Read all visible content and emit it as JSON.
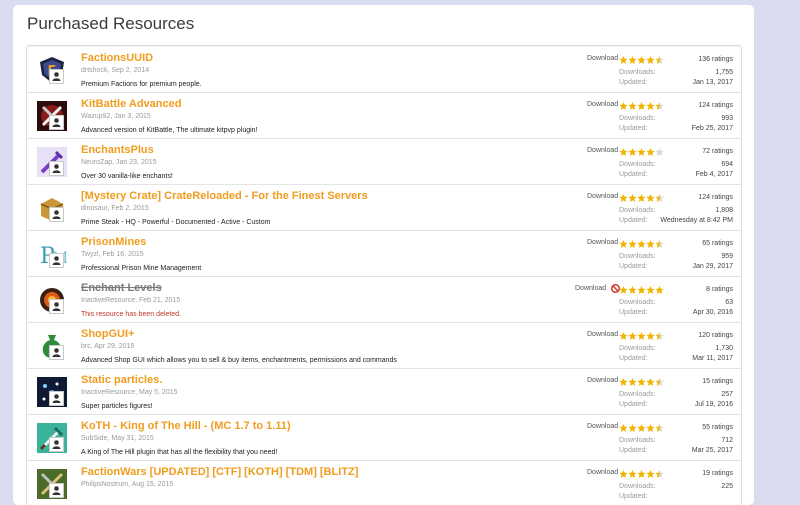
{
  "page": {
    "title": "Purchased Resources"
  },
  "labels": {
    "downloads": "Downloads:",
    "updated": "Updated:"
  },
  "colors": {
    "title": "#f09c1e",
    "star": "#f0b400",
    "deleted": "#c0392b"
  },
  "resources": [
    {
      "icon": "factions-shield-icon",
      "title": "FactionsUUID",
      "author": "drtshock",
      "date": "Sep 2, 2014",
      "description": "Premium Factions for premium people.",
      "download": "Download",
      "stars": 4.5,
      "ratings": "136 ratings",
      "downloads": "1,755",
      "updated": "Jan 13, 2017",
      "deleted": false
    },
    {
      "icon": "kitbattle-icon",
      "title": "KitBattle Advanced",
      "author": "Wazup92",
      "date": "Jan 3, 2015",
      "description": "Advanced version of KitBattle, The ultimate kitpvp plugin!",
      "download": "Download",
      "stars": 4.5,
      "ratings": "124 ratings",
      "downloads": "993",
      "updated": "Feb 25, 2017",
      "deleted": false
    },
    {
      "icon": "enchants-plus-icon",
      "title": "EnchantsPlus",
      "author": "NeuroZap",
      "date": "Jan 23, 2015",
      "description": "Over 30 vanilla-like enchants!",
      "download": "Download",
      "stars": 4,
      "ratings": "72 ratings",
      "downloads": "694",
      "updated": "Feb 4, 2017",
      "deleted": false
    },
    {
      "icon": "crate-icon",
      "title": "[Mystery Crate] CrateReloaded - For the Finest Servers",
      "author": "dinosaur",
      "date": "Feb 2, 2015",
      "description": "Prime Steak - HQ - Powerful - Documented - Active - Custom",
      "download": "Download",
      "stars": 4.5,
      "ratings": "124 ratings",
      "downloads": "1,808",
      "updated": "Wednesday at 8:42 PM",
      "deleted": false
    },
    {
      "icon": "prison-mines-icon",
      "title": "PrisonMines",
      "author": "Twyzl",
      "date": "Feb 16, 2015",
      "description": "Professional Prison Mine Management",
      "download": "Download",
      "stars": 4.5,
      "ratings": "65 ratings",
      "downloads": "959",
      "updated": "Jan 29, 2017",
      "deleted": false
    },
    {
      "icon": "enchant-levels-icon",
      "title": "Enchant Levels",
      "author": "InactiveResource",
      "date": "Feb 21, 2015",
      "description": "This resource has been deleted.",
      "download": "Download",
      "stars": 5,
      "ratings": "8 ratings",
      "downloads": "63",
      "updated": "Apr 30, 2016",
      "deleted": true
    },
    {
      "icon": "shopgui-money-bag-icon",
      "title": "ShopGUI+",
      "author": "brc",
      "date": "Apr 29, 2015",
      "description": "Advanced Shop GUI which allows you to sell & buy items, enchantments, permissions and commands",
      "download": "Download",
      "stars": 4.5,
      "ratings": "120 ratings",
      "downloads": "1,730",
      "updated": "Mar 11, 2017",
      "deleted": false
    },
    {
      "icon": "static-particles-icon",
      "title": "Static particles.",
      "author": "InactiveResource",
      "date": "May 5, 2015",
      "description": "Super particles figures!",
      "download": "Download",
      "stars": 4.5,
      "ratings": "15 ratings",
      "downloads": "257",
      "updated": "Jul 19, 2016",
      "deleted": false
    },
    {
      "icon": "koth-sword-icon",
      "title": "KoTH - King of The Hill - (MC 1.7 to 1.11)",
      "author": "SubSide",
      "date": "May 31, 2015",
      "description": "A King of The Hill plugin that has all the flexibility that you need!",
      "download": "Download",
      "stars": 4.5,
      "ratings": "55 ratings",
      "downloads": "712",
      "updated": "Mar 25, 2017",
      "deleted": false
    },
    {
      "icon": "factionwars-icon",
      "title": "FactionWars [UPDATED] [CTF] [KOTH] [TDM] [BLITZ]",
      "author": "PhilipsNostrum",
      "date": "Aug 15, 2015",
      "description": "",
      "download": "Download",
      "stars": 4.5,
      "ratings": "19 ratings",
      "downloads": "225",
      "updated": "",
      "deleted": false
    }
  ]
}
